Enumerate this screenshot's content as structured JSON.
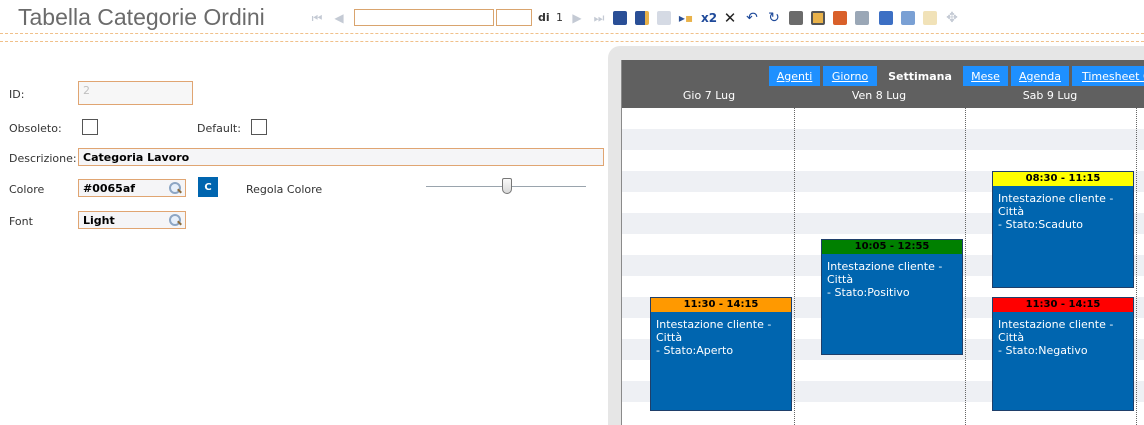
{
  "header": {
    "title": "Tabella Categorie Ordini"
  },
  "toolbar": {
    "record_field": "",
    "page_field": "",
    "di_label": "di",
    "total": "1",
    "x2_label": "x2"
  },
  "form": {
    "id_label": "ID:",
    "id_value": "2",
    "obsoleto_label": "Obsoleto:",
    "default_label": "Default:",
    "descrizione_label": "Descrizione:",
    "descrizione_value": "Categoria Lavoro",
    "colore_label": "Colore",
    "colore_value": "#0065af",
    "color_button": "C",
    "regola_colore_label": "Regola Colore",
    "font_label": "Font",
    "font_value": "Light"
  },
  "calendar": {
    "tabs": [
      "Agenti",
      "Giorno",
      "Settimana",
      "Mese",
      "Agenda",
      "Timesheet C"
    ],
    "active_tab": "Settimana",
    "days": [
      "Gio 7 Lug",
      "Ven 8 Lug",
      "Sab 9 Lug"
    ],
    "events": [
      {
        "time": "11:30 - 14:15",
        "line1": "Intestazione cliente - Città",
        "line2": "- Stato:Aperto",
        "color": "#ff9900"
      },
      {
        "time": "10:05 - 12:55",
        "line1": "Intestazione cliente - Città",
        "line2": "- Stato:Positivo",
        "color": "#008000"
      },
      {
        "time": "08:30 - 11:15",
        "line1": "Intestazione cliente - Città",
        "line2": "- Stato:Scaduto",
        "color": "#ffff00"
      },
      {
        "time": "11:30 - 14:15",
        "line1": "Intestazione cliente - Città",
        "line2": "- Stato:Negativo",
        "color": "#ff0000"
      }
    ],
    "event_color": "#0065af"
  }
}
